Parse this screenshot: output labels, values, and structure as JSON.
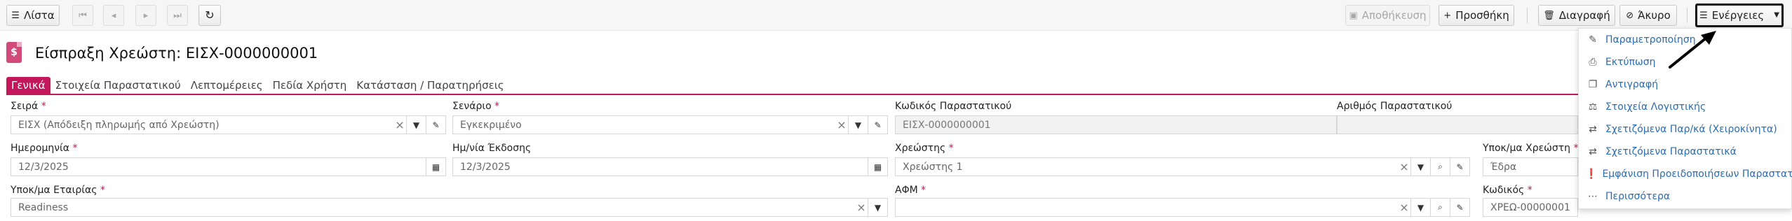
{
  "toolbar": {
    "list_label": "Λίστα",
    "save_label": "Αποθήκευση",
    "add_label": "Προσθήκη",
    "delete_label": "Διαγραφή",
    "cancel_label": "Άκυρο",
    "actions_label": "Ενέργειες"
  },
  "title": "Είσπραξη Χρεώστη: ΕΙΣΧ-0000000001",
  "tabs": [
    "Γενικά",
    "Στοιχεία Παραστατικού",
    "Λεπτομέρειες",
    "Πεδία Χρήστη",
    "Κατάσταση / Παρατηρήσεις"
  ],
  "form": {
    "series": {
      "label": "Σειρά",
      "value": "ΕΙΣΧ (Απόδειξη πληρωμής από Χρεώστη)"
    },
    "scenario": {
      "label": "Σενάριο",
      "value": "Εγκεκριμένο"
    },
    "doc_code": {
      "label": "Κωδικός Παραστατικού",
      "value": "ΕΙΣΧ-0000000001"
    },
    "doc_number": {
      "label": "Αριθμός Παραστατικού",
      "value": ""
    },
    "date": {
      "label": "Ημερομηνία",
      "value": "12/3/2025"
    },
    "issue_date": {
      "label": "Ημ/νία Έκδοσης",
      "value": "12/3/2025"
    },
    "debtor": {
      "label": "Χρεώστης",
      "value": "Χρεώστης 1"
    },
    "debtor_branch": {
      "label": "Υποκ/μα Χρεώστη",
      "value": "Έδρα"
    },
    "company_branch": {
      "label": "Υποκ/μα Εταιρίας",
      "value": "Readiness"
    },
    "vat": {
      "label": "ΑΦΜ",
      "value": ""
    },
    "code": {
      "label": "Κωδικός",
      "value": "ΧΡΕΩ-00000001"
    }
  },
  "actions_menu": [
    {
      "label": "Παραμετροποίηση",
      "icon": "edit-icon"
    },
    {
      "label": "Εκτύπωση",
      "icon": "print-icon"
    },
    {
      "label": "Αντιγραφή",
      "icon": "copy-icon"
    },
    {
      "label": "Στοιχεία Λογιστικής",
      "icon": "accounting-icon"
    },
    {
      "label": "Σχετιζόμενα Παρ/κά (Χειροκίνητα)",
      "icon": "exchange-icon"
    },
    {
      "label": "Σχετιζόμενα Παραστατικά",
      "icon": "exchange-icon"
    },
    {
      "label": "Εμφάνιση Προειδοποιήσεων Παραστατικού",
      "icon": "warning-icon"
    },
    {
      "label": "Περισσότερα",
      "icon": "more-icon"
    }
  ],
  "colors": {
    "accent": "#c2185b",
    "link": "#2b6cb0"
  }
}
